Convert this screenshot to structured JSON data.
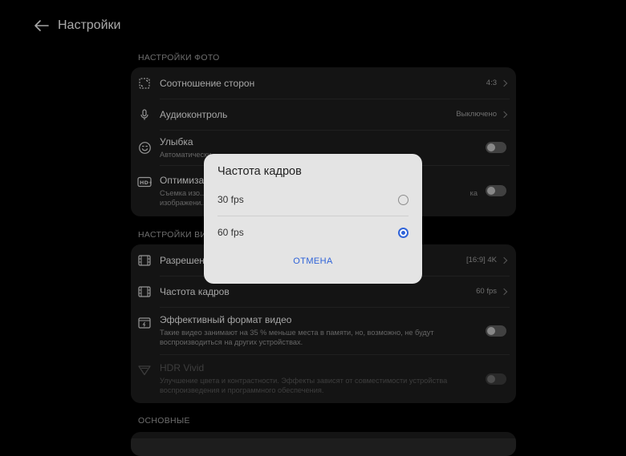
{
  "header": {
    "title": "Настройки",
    "back_icon": "arrow-left-icon"
  },
  "photo_section": {
    "label": "НАСТРОЙКИ ФОТО",
    "rows": [
      {
        "title": "Соотношение сторон",
        "value": "4:3",
        "icon": "aspect-ratio-icon"
      },
      {
        "title": "Аудиоконтроль",
        "value": "Выключено",
        "icon": "microphone-icon"
      },
      {
        "title": "Улыбка",
        "subtitle": "Автоматически...",
        "toggle": false,
        "icon": "smile-icon"
      },
      {
        "title": "Оптимиза...",
        "subtitle_line1": "Съемка изо...",
        "subtitle_line2": "изображени...",
        "subtitle_tail": "ка",
        "toggle": false,
        "icon": "hd-icon"
      }
    ]
  },
  "video_section": {
    "label": "НАСТРОЙКИ ВИД...",
    "rows": [
      {
        "title": "Разрешени...",
        "value": "[16:9] 4K",
        "icon": "film-icon"
      },
      {
        "title": "Частота кадров",
        "value": "60 fps",
        "icon": "film-frame-icon"
      },
      {
        "title": "Эффективный формат видео",
        "subtitle_line1": "Такие видео занимают на 35 % меньше места в памяти, но, возможно, не будут",
        "subtitle_line2": "воспроизводиться на других устройствах.",
        "toggle": false,
        "icon": "video-format-icon"
      },
      {
        "title": "HDR Vivid",
        "subtitle_line1": "Улучшение цвета и контрастности. Эффекты зависят от совместимости устройства",
        "subtitle_line2": "воспроизведения и программного обеспечения.",
        "toggle": false,
        "disabled": true,
        "icon": "hdr-icon"
      }
    ]
  },
  "main_section": {
    "label": "ОСНОВНЫЕ"
  },
  "dialog": {
    "title": "Частота кадров",
    "options": [
      {
        "label": "30 fps",
        "selected": false
      },
      {
        "label": "60 fps",
        "selected": true
      }
    ],
    "cancel_label": "ОТМЕНА"
  },
  "colors": {
    "accent": "#2f63d8",
    "background": "#000000",
    "card": "#1d1d1d",
    "dialog": "#e4e4e4"
  }
}
